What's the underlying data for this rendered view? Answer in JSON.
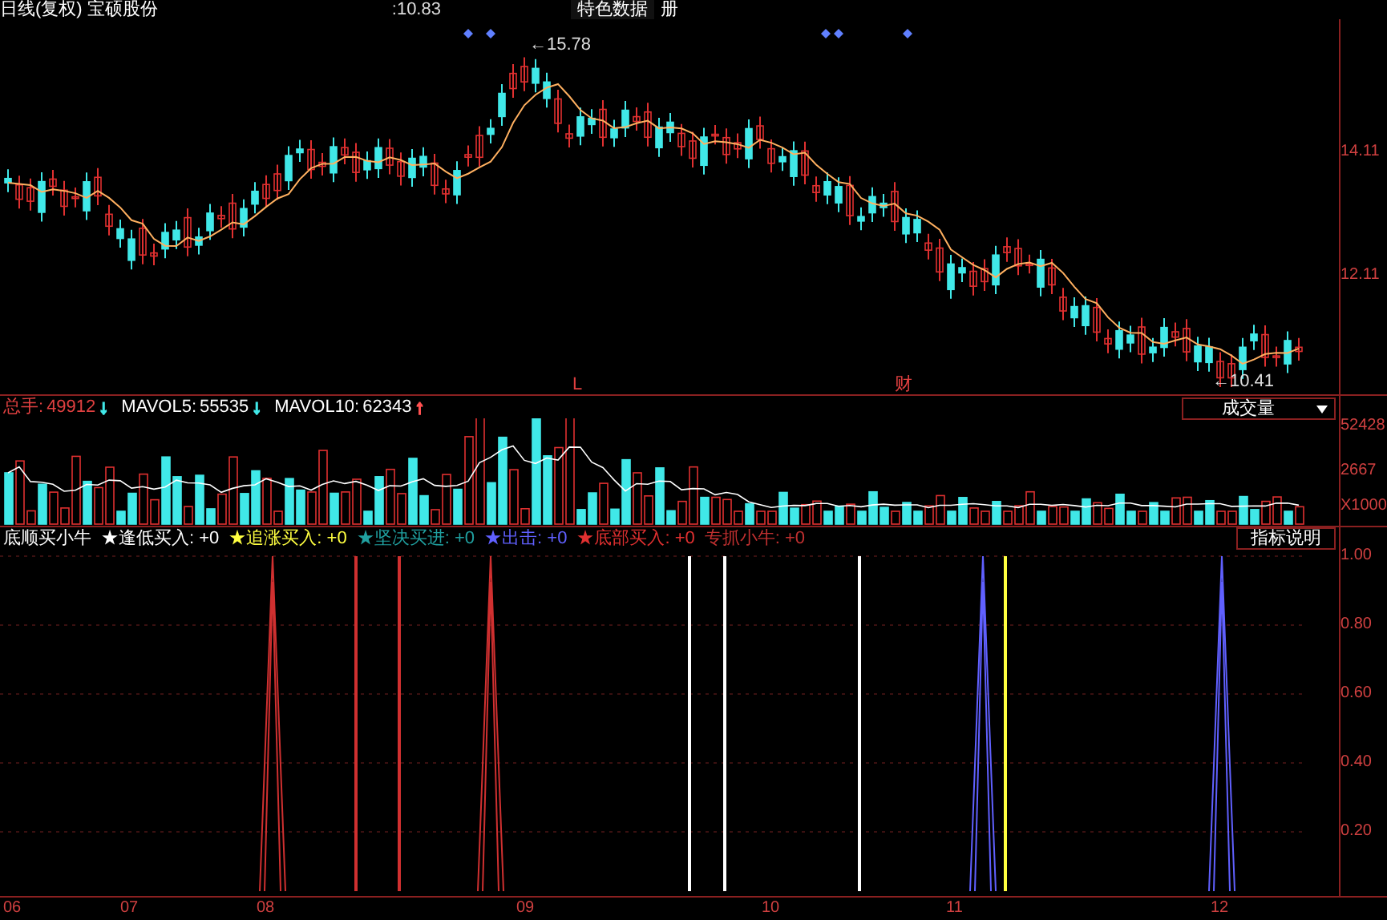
{
  "header": {
    "period": "日线(复权)",
    "stock": "宝硕股份",
    "price": ":10.83",
    "feature_tab": "特色数据",
    "feature_tab_cut": "册"
  },
  "price_chart": {
    "high_label": "←15.78",
    "low_label": "←10.41",
    "markers": [
      {
        "text": "L"
      },
      {
        "text": "财"
      }
    ],
    "axis": [
      "14.11",
      "12.11"
    ]
  },
  "volume_pane": {
    "legend": [
      {
        "label": "总手:",
        "value": "49912",
        "arrow": {
          "text": "↓",
          "color": "#40e8e8"
        },
        "color": "#e04040"
      },
      {
        "label": "MAVOL5:",
        "value": "55535",
        "arrow": {
          "text": "↓",
          "color": "#40e8e8"
        },
        "color": "#ffffff"
      },
      {
        "label": "MAVOL10:",
        "value": "62343",
        "arrow": {
          "text": "↑",
          "color": "#ff5050"
        },
        "color": "#ffffff"
      }
    ],
    "selector": "成交量",
    "axis": [
      "52428",
      "2667",
      "X1000"
    ]
  },
  "indicator_pane": {
    "name": "底顺买小牛",
    "legend": [
      {
        "star": "★",
        "label": "逢低买入:",
        "value": "+0",
        "color": "#ffffff"
      },
      {
        "star": "★",
        "label": "追涨买入:",
        "value": "+0",
        "color": "#ffff40"
      },
      {
        "star": "★",
        "label": "坚决买进:",
        "value": "+0",
        "color": "#20a0a0"
      },
      {
        "star": "★",
        "label": "出击:",
        "value": "+0",
        "color": "#6060ff"
      },
      {
        "star": "★",
        "label": "底部买入:",
        "value": "+0",
        "color": "#e03030"
      },
      {
        "label": "专抓小牛:",
        "value": "+0",
        "color": "#c03030"
      }
    ],
    "help_button": "指标说明",
    "axis": [
      "1.00",
      "0.80",
      "0.60",
      "0.40",
      "0.20"
    ]
  },
  "x_axis": [
    "06",
    "07",
    "08",
    "09",
    "10",
    "11",
    "12"
  ]
}
